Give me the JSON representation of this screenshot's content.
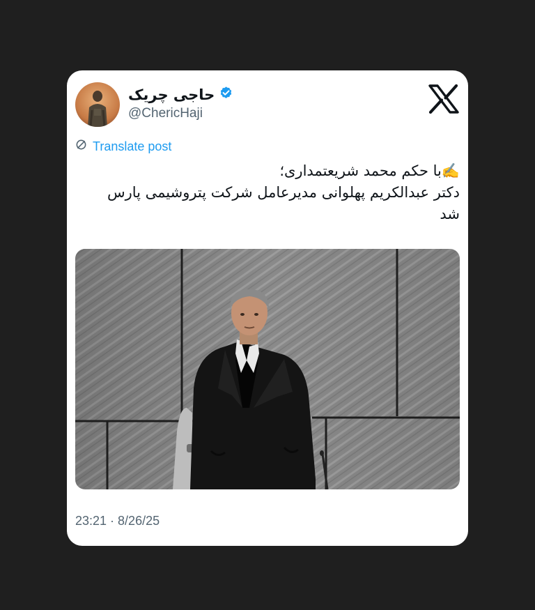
{
  "author": {
    "display_name": "حاجی چریک",
    "handle": "@ChericHaji",
    "verified_icon": "verified-badge-icon",
    "avatar_icon": "avatar-photo"
  },
  "platform_icon": "x-logo-icon",
  "translate": {
    "label": "Translate post",
    "icon": "translate-globe-icon"
  },
  "post": {
    "lines": [
      "✍️با حکم محمد شریعتمداری؛",
      "دکتر عبدالکریم پهلوانی مدیرعامل شرکت پتروشیمی پارس",
      "شد"
    ],
    "media_icon": "man-in-black-suit-photo"
  },
  "timestamp": "23:21 · 8/26/25",
  "colors": {
    "background": "#1f1f1f",
    "card": "#ffffff",
    "link": "#1d9bf0",
    "verified": "#1d9bf0",
    "secondary_text": "#536471"
  }
}
